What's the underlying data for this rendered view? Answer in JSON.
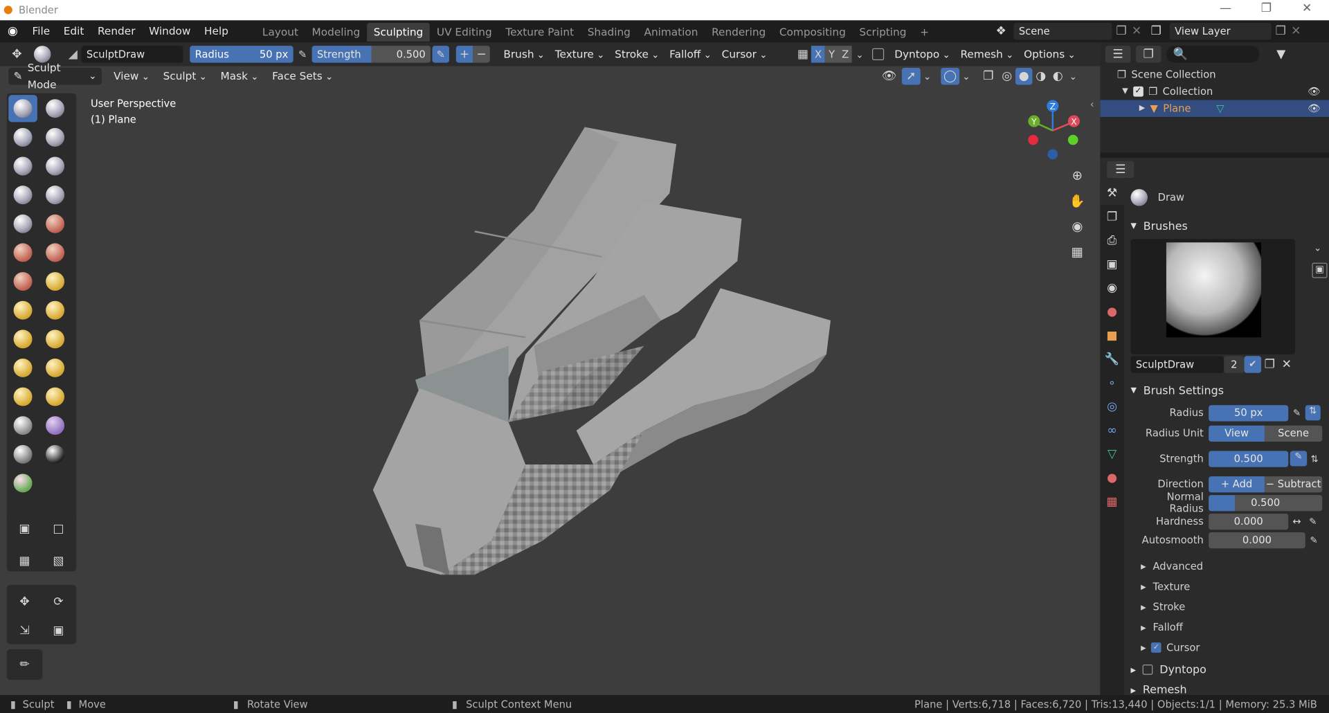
{
  "window": {
    "title": "Blender",
    "minimize": "—",
    "maximize": "❐",
    "close": "✕"
  },
  "menu": {
    "items": [
      "File",
      "Edit",
      "Render",
      "Window",
      "Help"
    ]
  },
  "workspaces": {
    "tabs": [
      "Layout",
      "Modeling",
      "Sculpting",
      "UV Editing",
      "Texture Paint",
      "Shading",
      "Animation",
      "Rendering",
      "Compositing",
      "Scripting"
    ],
    "active": "Sculpting",
    "add": "+"
  },
  "scene": {
    "label": "Scene",
    "view_layer": "View Layer"
  },
  "toolheader": {
    "brush_name": "SculptDraw",
    "radius_label": "Radius",
    "radius_value": "50 px",
    "strength_label": "Strength",
    "strength_value": "0.500",
    "brush": "Brush",
    "texture": "Texture",
    "stroke": "Stroke",
    "falloff": "Falloff",
    "cursor": "Cursor",
    "sym_x": "X",
    "sym_y": "Y",
    "sym_z": "Z",
    "dyntopo": "Dyntopo",
    "remesh": "Remesh",
    "options": "Options"
  },
  "viewport_header": {
    "mode": "Sculpt Mode",
    "menus": [
      "View",
      "Sculpt",
      "Mask",
      "Face Sets"
    ]
  },
  "viewport": {
    "perspective": "User Perspective",
    "object": "(1) Plane"
  },
  "gizmo": {
    "x": "X",
    "y": "Y",
    "z": "Z"
  },
  "outliner": {
    "scene_collection": "Scene Collection",
    "collection": "Collection",
    "object": "Plane"
  },
  "properties": {
    "brush_title": "Draw",
    "brushes_panel": "Brushes",
    "brush_datablock": "SculptDraw",
    "users": "2",
    "brush_settings": "Brush Settings",
    "radius_label": "Radius",
    "radius_value": "50 px",
    "radius_unit_label": "Radius Unit",
    "unit_view": "View",
    "unit_scene": "Scene",
    "strength_label": "Strength",
    "strength_value": "0.500",
    "direction_label": "Direction",
    "dir_add": "Add",
    "dir_subtract": "Subtract",
    "normal_radius_label": "Normal Radius",
    "normal_radius_value": "0.500",
    "hardness_label": "Hardness",
    "hardness_value": "0.000",
    "autosmooth_label": "Autosmooth",
    "autosmooth_value": "0.000",
    "subpanels": [
      "Advanced",
      "Texture",
      "Stroke",
      "Falloff"
    ],
    "cursor_label": "Cursor",
    "dyntopo_label": "Dyntopo",
    "remesh_label": "Remesh"
  },
  "statusbar": {
    "sculpt": "Sculpt",
    "move": "Move",
    "rotate": "Rotate View",
    "context": "Sculpt Context Menu",
    "stats": "Plane | Verts:6,718 | Faces:6,720 | Tris:13,440 | Objects:1/1 | Memory: 25.3 MiB"
  },
  "colors": {
    "accent": "#4772b3",
    "active_object": "#e8a050"
  }
}
